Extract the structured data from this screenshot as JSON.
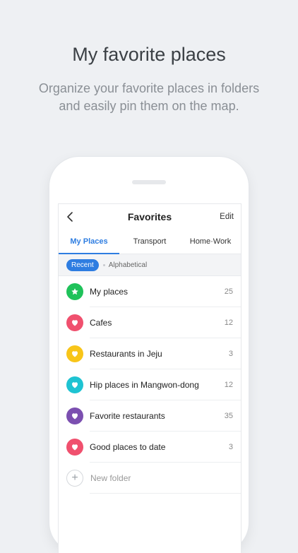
{
  "promo": {
    "title": "My favorite places",
    "subtitle_line1": "Organize your favorite places in folders",
    "subtitle_line2": "and easily pin them on the map."
  },
  "nav": {
    "title": "Favorites",
    "edit_label": "Edit"
  },
  "tabs": [
    {
      "label": "My Places",
      "active": true
    },
    {
      "label": "Transport",
      "active": false
    },
    {
      "label": "Home·Work",
      "active": false
    }
  ],
  "sort": {
    "active": "Recent",
    "other": "Alphabetical"
  },
  "folders": [
    {
      "name": "My places",
      "count": "25",
      "color": "#1fc25a",
      "icon": "star-icon"
    },
    {
      "name": "Cafes",
      "count": "12",
      "color": "#f0506e",
      "icon": "heart-icon"
    },
    {
      "name": "Restaurants in Jeju",
      "count": "3",
      "color": "#f8c519",
      "icon": "heart-icon"
    },
    {
      "name": "Hip places in Mangwon-dong",
      "count": "12",
      "color": "#1ec3d2",
      "icon": "heart-icon"
    },
    {
      "name": "Favorite restaurants",
      "count": "35",
      "color": "#7b4fb0",
      "icon": "heart-icon"
    },
    {
      "name": "Good places to date",
      "count": "3",
      "color": "#f0506e",
      "icon": "heart-icon"
    }
  ],
  "new_folder": {
    "label": "New folder",
    "icon": "plus-icon"
  },
  "colors": {
    "accent": "#2e7de1"
  }
}
